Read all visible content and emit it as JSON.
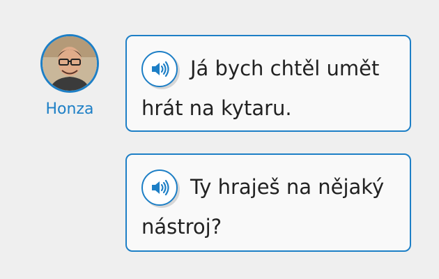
{
  "speaker": {
    "name": "Honza",
    "avatar_icon": "person-avatar-icon"
  },
  "messages": [
    {
      "text": "Já bych chtěl umět hrát na kytaru.",
      "audio_icon": "speaker-volume-icon"
    },
    {
      "text": "Ty hraješ na nějaký nástroj?",
      "audio_icon": "speaker-volume-icon"
    }
  ],
  "colors": {
    "accent": "#1d7fc6",
    "background": "#efefef",
    "bubble_background": "#f9f9f9",
    "text": "#222222"
  }
}
